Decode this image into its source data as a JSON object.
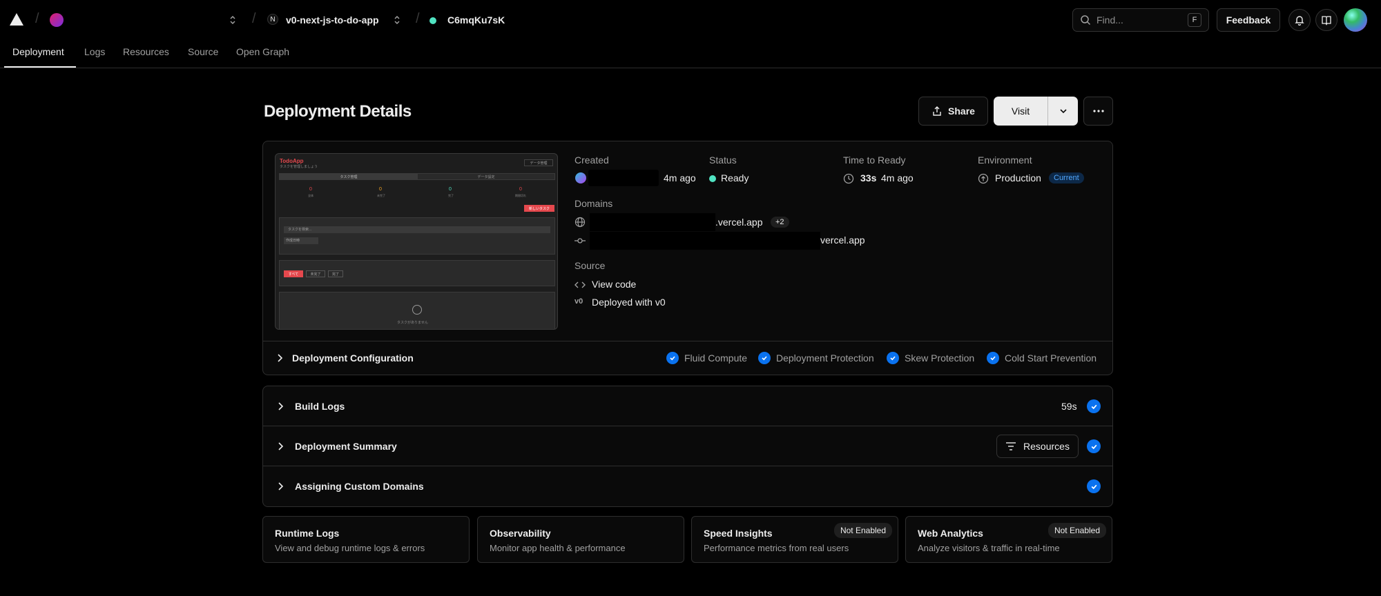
{
  "topbar": {
    "project_name": "v0-next-js-to-do-app",
    "deployment_id": "C6mqKu7sK",
    "find_placeholder": "Find...",
    "find_shortcut": "F",
    "feedback_label": "Feedback"
  },
  "tabs": [
    {
      "label": "Deployment",
      "active": true
    },
    {
      "label": "Logs"
    },
    {
      "label": "Resources"
    },
    {
      "label": "Source"
    },
    {
      "label": "Open Graph"
    }
  ],
  "header": {
    "title": "Deployment Details",
    "share_label": "Share",
    "visit_label": "Visit"
  },
  "preview": {
    "app_title": "TodoApp",
    "app_subtitle": "タスクを管理しましょう",
    "theme_button": "データ管理",
    "tab1": "タスク管理",
    "tab2": "データ設定",
    "stats": [
      {
        "value": "0",
        "label": "全体"
      },
      {
        "value": "0",
        "label": "未完了"
      },
      {
        "value": "0",
        "label": "完了"
      },
      {
        "value": "0",
        "label": "期限切れ"
      }
    ],
    "new_task_button": "新しいタスク",
    "search_placeholder": "タスクを検索...",
    "sort_label": "作成日時",
    "filters": [
      "すべて",
      "未完了",
      "完了"
    ],
    "empty_text": "タスクがありません"
  },
  "details": {
    "created_label": "Created",
    "created_time": "4m ago",
    "status_label": "Status",
    "status_value": "Ready",
    "ttr_label": "Time to Ready",
    "ttr_value": "33s",
    "ttr_ago": "4m ago",
    "env_label": "Environment",
    "env_value": "Production",
    "env_badge": "Current",
    "domains_label": "Domains",
    "domain1_suffix": ".vercel.app",
    "domain1_more": "+2",
    "domain2_suffix": "vercel.app",
    "source_label": "Source",
    "source_view": "View code",
    "source_deployed": "Deployed with v0"
  },
  "config": {
    "title": "Deployment Configuration",
    "features": [
      "Fluid Compute",
      "Deployment Protection",
      "Skew Protection",
      "Cold Start Prevention"
    ]
  },
  "steps": {
    "build_logs": "Build Logs",
    "build_duration": "59s",
    "summary": "Deployment Summary",
    "resources_label": "Resources",
    "domains": "Assigning Custom Domains"
  },
  "cards": [
    {
      "title": "Runtime Logs",
      "desc": "View and debug runtime logs & errors",
      "badge": ""
    },
    {
      "title": "Observability",
      "desc": "Monitor app health & performance",
      "badge": ""
    },
    {
      "title": "Speed Insights",
      "desc": "Performance metrics from real users",
      "badge": "Not Enabled"
    },
    {
      "title": "Web Analytics",
      "desc": "Analyze visitors & traffic in real-time",
      "badge": "Not Enabled"
    }
  ],
  "colors": {
    "accent_blue": "#0a72ef",
    "ready_green": "#50e3c2",
    "preview_red": "#e5484d"
  }
}
